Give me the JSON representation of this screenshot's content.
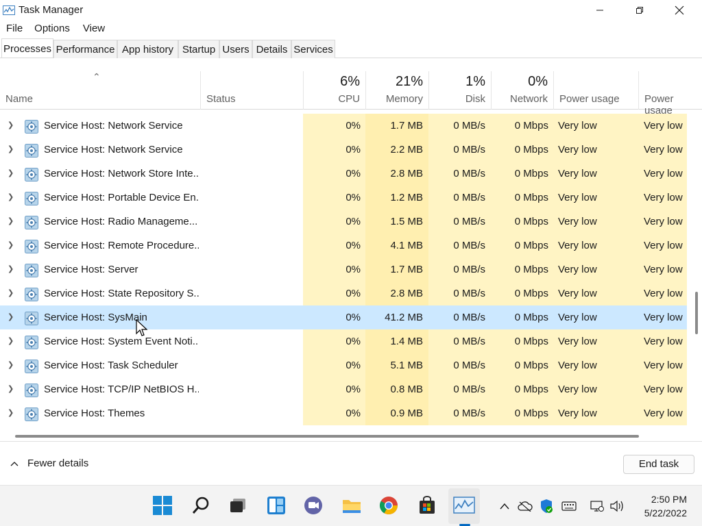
{
  "window": {
    "title": "Task Manager"
  },
  "menu": [
    "File",
    "Options",
    "View"
  ],
  "tabs": [
    "Processes",
    "Performance",
    "App history",
    "Startup",
    "Users",
    "Details",
    "Services"
  ],
  "active_tab": "Processes",
  "header": {
    "name": "Name",
    "status": "Status",
    "cpu_pct": "6%",
    "cpu": "CPU",
    "mem_pct": "21%",
    "mem": "Memory",
    "disk_pct": "1%",
    "disk": "Disk",
    "net_pct": "0%",
    "net": "Network",
    "power": "Power usage",
    "power2": "Power usage"
  },
  "rows": [
    {
      "name": "Service Host: Network Service",
      "cpu": "0%",
      "mem": "1.7 MB",
      "disk": "0 MB/s",
      "net": "0 Mbps",
      "power": "Very low",
      "power2": "Very low"
    },
    {
      "name": "Service Host: Network Service",
      "cpu": "0%",
      "mem": "2.2 MB",
      "disk": "0 MB/s",
      "net": "0 Mbps",
      "power": "Very low",
      "power2": "Very low"
    },
    {
      "name": "Service Host: Network Store Inte...",
      "cpu": "0%",
      "mem": "2.8 MB",
      "disk": "0 MB/s",
      "net": "0 Mbps",
      "power": "Very low",
      "power2": "Very low"
    },
    {
      "name": "Service Host: Portable Device En...",
      "cpu": "0%",
      "mem": "1.2 MB",
      "disk": "0 MB/s",
      "net": "0 Mbps",
      "power": "Very low",
      "power2": "Very low"
    },
    {
      "name": "Service Host: Radio Manageme...",
      "cpu": "0%",
      "mem": "1.5 MB",
      "disk": "0 MB/s",
      "net": "0 Mbps",
      "power": "Very low",
      "power2": "Very low"
    },
    {
      "name": "Service Host: Remote Procedure...",
      "cpu": "0%",
      "mem": "4.1 MB",
      "disk": "0 MB/s",
      "net": "0 Mbps",
      "power": "Very low",
      "power2": "Very low"
    },
    {
      "name": "Service Host: Server",
      "cpu": "0%",
      "mem": "1.7 MB",
      "disk": "0 MB/s",
      "net": "0 Mbps",
      "power": "Very low",
      "power2": "Very low"
    },
    {
      "name": "Service Host: State Repository S...",
      "cpu": "0%",
      "mem": "2.8 MB",
      "disk": "0 MB/s",
      "net": "0 Mbps",
      "power": "Very low",
      "power2": "Very low"
    },
    {
      "name": "Service Host: SysMain",
      "cpu": "0%",
      "mem": "41.2 MB",
      "disk": "0 MB/s",
      "net": "0 Mbps",
      "power": "Very low",
      "power2": "Very low",
      "selected": true
    },
    {
      "name": "Service Host: System Event Noti...",
      "cpu": "0%",
      "mem": "1.4 MB",
      "disk": "0 MB/s",
      "net": "0 Mbps",
      "power": "Very low",
      "power2": "Very low"
    },
    {
      "name": "Service Host: Task Scheduler",
      "cpu": "0%",
      "mem": "5.1 MB",
      "disk": "0 MB/s",
      "net": "0 Mbps",
      "power": "Very low",
      "power2": "Very low"
    },
    {
      "name": "Service Host: TCP/IP NetBIOS H...",
      "cpu": "0%",
      "mem": "0.8 MB",
      "disk": "0 MB/s",
      "net": "0 Mbps",
      "power": "Very low",
      "power2": "Very low"
    },
    {
      "name": "Service Host: Themes",
      "cpu": "0%",
      "mem": "0.9 MB",
      "disk": "0 MB/s",
      "net": "0 Mbps",
      "power": "Very low",
      "power2": "Very low"
    }
  ],
  "footer": {
    "fewer_details": "Fewer details",
    "end_task": "End task"
  },
  "taskbar": {
    "apps": [
      "windows-start-icon",
      "search-icon",
      "task-view-icon",
      "widgets-icon",
      "teams-chat-icon",
      "file-explorer-icon",
      "chrome-icon",
      "store-icon",
      "task-manager-icon"
    ],
    "tray": [
      "chevron-up-icon",
      "onedrive-icon",
      "defender-icon",
      "keyboard-icon",
      "network-icon",
      "volume-icon"
    ]
  },
  "clock": {
    "time": "2:50 PM",
    "date": "5/22/2022"
  },
  "colors": {
    "selected_row": "#cce8ff",
    "heat_light": "#fff4c4",
    "heat_memory": "#ffefb0",
    "accent": "#0067c0"
  }
}
